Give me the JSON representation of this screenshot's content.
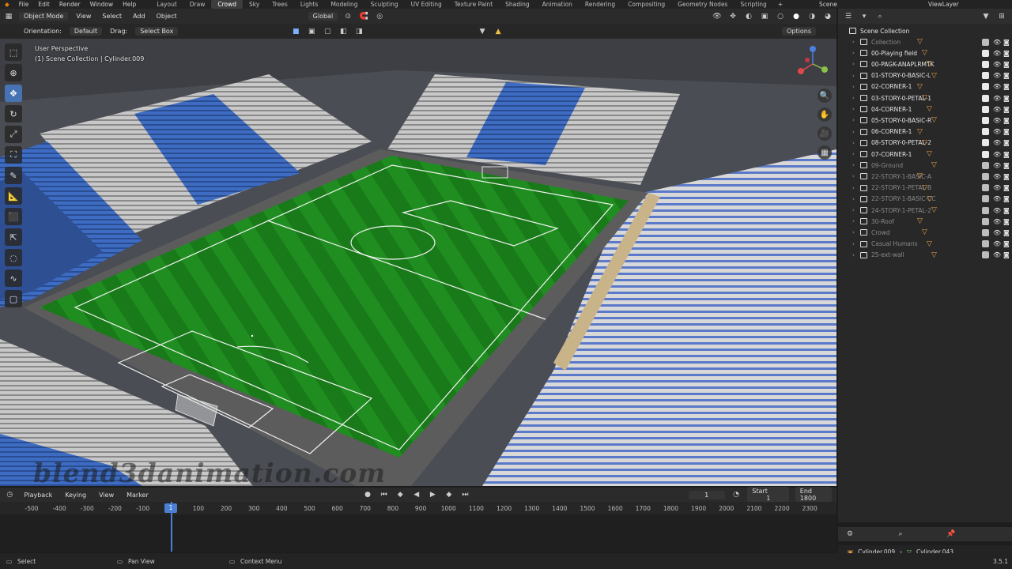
{
  "menu": [
    "File",
    "Edit",
    "Render",
    "Window",
    "Help"
  ],
  "workspaces": [
    "Layout",
    "Draw",
    "Crowd",
    "Sky",
    "Trees",
    "Lights",
    "Modeling",
    "Sculpting",
    "UV Editing",
    "Texture Paint",
    "Shading",
    "Animation",
    "Rendering",
    "Compositing",
    "Geometry Nodes",
    "Scripting"
  ],
  "active_workspace": "Crowd",
  "scene_name": "Scene",
  "view_layer": "ViewLayer",
  "viewport_header": {
    "mode": "Object Mode",
    "view": "View",
    "select": "Select",
    "add": "Add",
    "object": "Object",
    "orientation_menu": "Global"
  },
  "tool_header": {
    "orientation_label": "Orientation:",
    "orientation_value": "Default",
    "drag_label": "Drag:",
    "drag_value": "Select Box",
    "options": "Options"
  },
  "viewport_info": {
    "perspective": "User Perspective",
    "collection": "(1) Scene Collection | Cylinder.009"
  },
  "watermark": "blend3danimation.com",
  "outliner": {
    "root": "Scene Collection",
    "items": [
      {
        "name": "Collection",
        "dim": true
      },
      {
        "name": "00-Playing field",
        "dim": false
      },
      {
        "name": "00-PAGK-ANAPLRMTK",
        "dim": false
      },
      {
        "name": "01-STORY-0-BASIC-L",
        "dim": false
      },
      {
        "name": "02-CORNER-1",
        "dim": false
      },
      {
        "name": "03-STORY-0-PETAL-1",
        "dim": false
      },
      {
        "name": "04-CORNER-1",
        "dim": false
      },
      {
        "name": "05-STORY-0-BASIC-R",
        "dim": false
      },
      {
        "name": "06-CORNER-1",
        "dim": false
      },
      {
        "name": "08-STORY-0-PETAL-2",
        "dim": false
      },
      {
        "name": "07-CORNER-1",
        "dim": false
      },
      {
        "name": "09-Ground",
        "dim": true
      },
      {
        "name": "22-STORY-1-BASIC-A",
        "dim": true
      },
      {
        "name": "22-STORY-1-PETAL-B",
        "dim": true
      },
      {
        "name": "22-STORY-1-BASIC-CC",
        "dim": true
      },
      {
        "name": "24-STORY-1-PETAL-2",
        "dim": true
      },
      {
        "name": "30-Roof",
        "dim": true
      },
      {
        "name": "Crowd",
        "dim": true
      },
      {
        "name": "Casual Humans",
        "dim": true
      },
      {
        "name": "25-ext-wall",
        "dim": true
      }
    ]
  },
  "properties_breadcrumb": {
    "object": "Cylinder.009",
    "data": "Cylinder.043"
  },
  "timeline": {
    "playback": "Playback",
    "keying": "Keying",
    "view": "View",
    "marker": "Marker",
    "current_frame": "1",
    "start_label": "Start",
    "start": "1",
    "end_label": "End",
    "end": "1800",
    "ticks": [
      "-500",
      "-400",
      "-300",
      "-200",
      "-100",
      "",
      "100",
      "200",
      "300",
      "400",
      "500",
      "600",
      "700",
      "800",
      "900",
      "1000",
      "1100",
      "1200",
      "1300",
      "1400",
      "1500",
      "1600",
      "1700",
      "1800",
      "1900",
      "2000",
      "2100",
      "2200",
      "2300"
    ],
    "playhead_label": "1"
  },
  "status": {
    "select": "Select",
    "pan": "Pan View",
    "context": "Context Menu",
    "version": "3.5.1"
  }
}
